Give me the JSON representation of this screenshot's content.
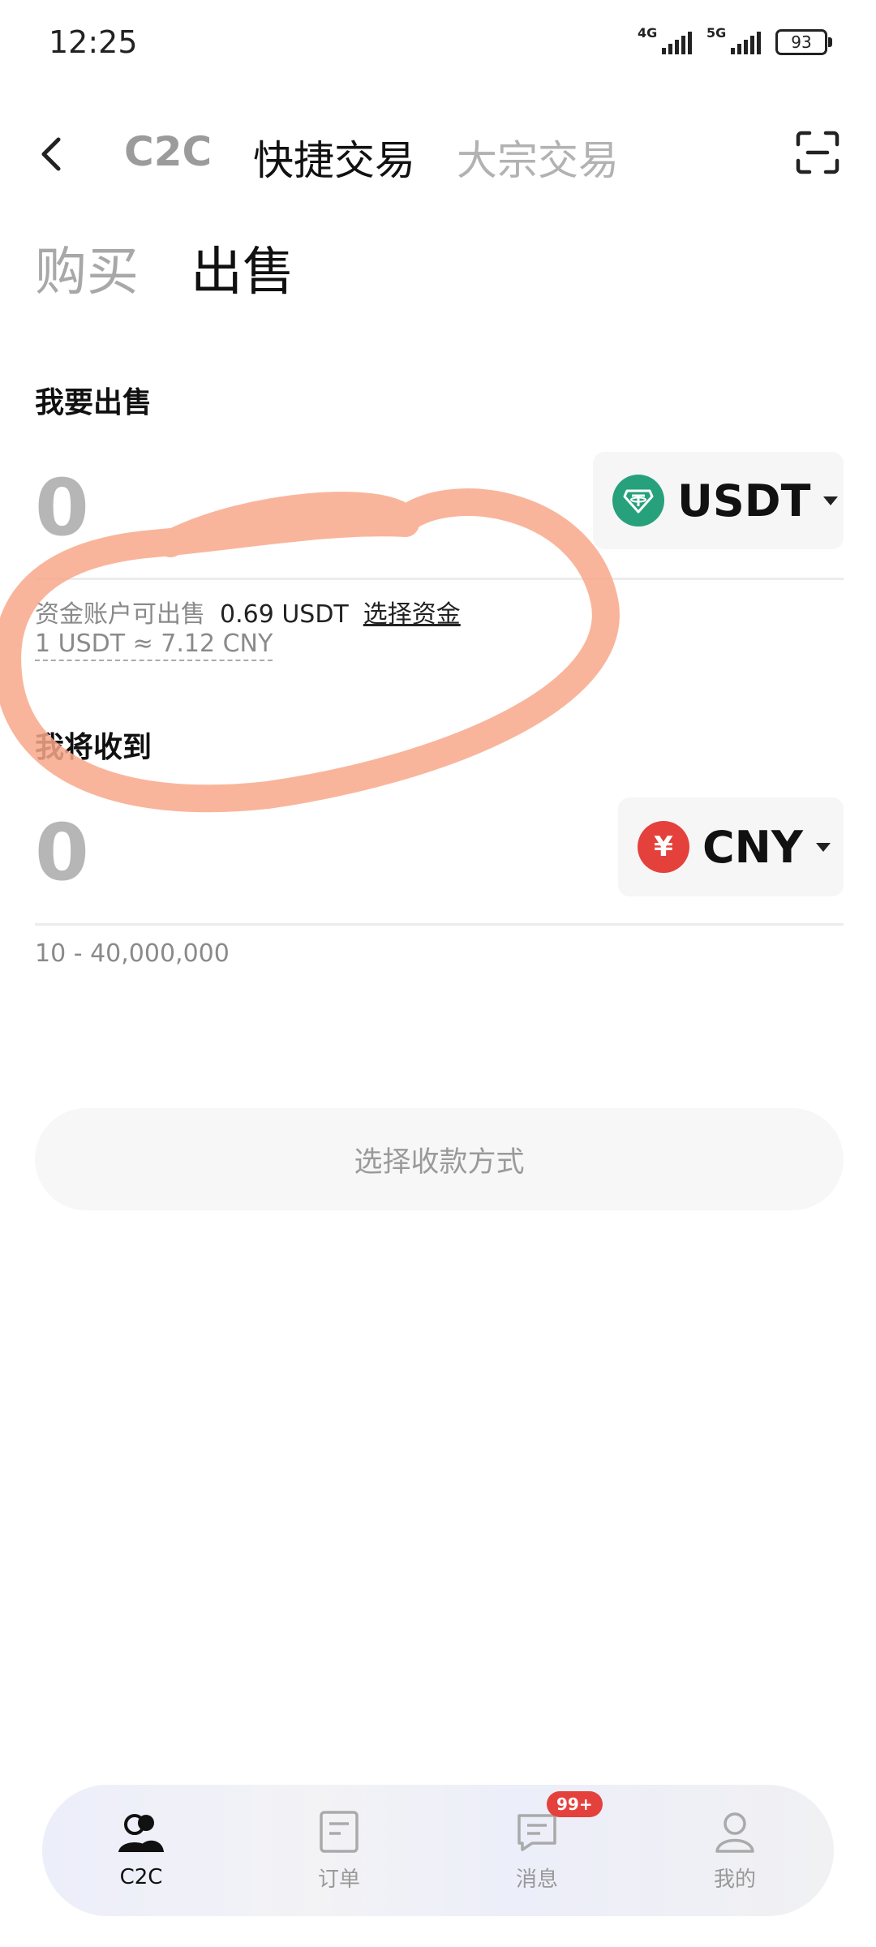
{
  "status_bar": {
    "time": "12:25",
    "signal1": "4G",
    "signal2": "5G",
    "battery": "93"
  },
  "top_nav": {
    "tabs": [
      "C2C",
      "快捷交易",
      "大宗交易"
    ],
    "active_index": 1
  },
  "mode_tabs": {
    "buy": "购买",
    "sell": "出售",
    "active": "sell"
  },
  "sell_section": {
    "label": "我要出售",
    "amount": "0",
    "currency": "USDT",
    "available_label": "资金账户可出售",
    "available_value": "0.69 USDT",
    "select_funds": "选择资金",
    "rate": "1 USDT ≈ 7.12 CNY"
  },
  "receive_section": {
    "label": "我将收到",
    "amount": "0",
    "currency": "CNY",
    "currency_symbol": "¥",
    "range": "10 - 40,000,000"
  },
  "payment_button": "选择收款方式",
  "bottom_nav": {
    "items": [
      {
        "label": "C2C",
        "icon": "users-icon",
        "active": true
      },
      {
        "label": "订单",
        "icon": "order-icon",
        "active": false
      },
      {
        "label": "消息",
        "icon": "message-icon",
        "active": false,
        "badge": "99+"
      },
      {
        "label": "我的",
        "icon": "profile-icon",
        "active": false
      }
    ]
  },
  "colors": {
    "usdt": "#26a17b",
    "cny": "#e5413c",
    "annotation": "#f8a88a"
  }
}
